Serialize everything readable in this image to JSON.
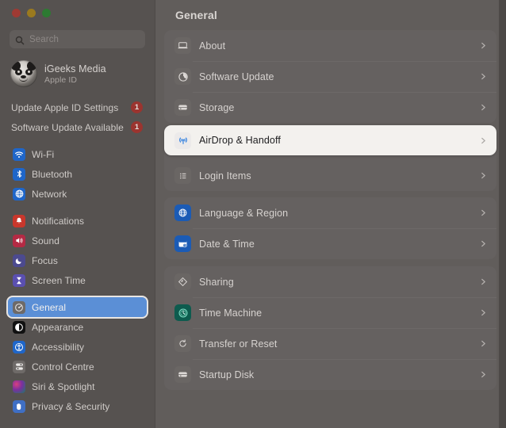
{
  "window": {
    "traffic_lights": [
      "close",
      "minimize",
      "zoom"
    ],
    "sidebar": {
      "search": {
        "placeholder": "Search",
        "value": ""
      },
      "account": {
        "name": "iGeeks Media",
        "subtitle": "Apple ID"
      },
      "alerts": [
        {
          "label": "Update Apple ID Settings",
          "badge": "1"
        },
        {
          "label": "Software Update Available",
          "badge": "1"
        }
      ],
      "groups": [
        {
          "items": [
            {
              "label": "Wi-Fi",
              "icon": "wifi-icon",
              "color": "#1f66c9"
            },
            {
              "label": "Bluetooth",
              "icon": "bluetooth-icon",
              "color": "#1f66c9"
            },
            {
              "label": "Network",
              "icon": "network-globe-icon",
              "color": "#1f66c9"
            }
          ]
        },
        {
          "items": [
            {
              "label": "Notifications",
              "icon": "notifications-bell-icon",
              "color": "#c9372c"
            },
            {
              "label": "Sound",
              "icon": "sound-speaker-icon",
              "color": "#b42a44"
            },
            {
              "label": "Focus",
              "icon": "focus-moon-icon",
              "color": "#4c4a8f"
            },
            {
              "label": "Screen Time",
              "icon": "screen-time-hourglass-icon",
              "color": "#5a4fb0"
            }
          ]
        },
        {
          "items": [
            {
              "label": "General",
              "icon": "general-gear-icon",
              "color": "#6e6a68",
              "selected": true
            },
            {
              "label": "Appearance",
              "icon": "appearance-contrast-icon",
              "color": "#1a1a1a"
            },
            {
              "label": "Accessibility",
              "icon": "accessibility-person-icon",
              "color": "#1f66c9"
            },
            {
              "label": "Control Centre",
              "icon": "control-centre-icon",
              "color": "#6e6a68"
            },
            {
              "label": "Siri & Spotlight",
              "icon": "siri-icon",
              "color": "#2a2a3a"
            },
            {
              "label": "Privacy & Security",
              "icon": "privacy-hand-icon",
              "color": "#3f6fc4"
            }
          ]
        }
      ]
    },
    "content": {
      "title": "General",
      "groups": [
        {
          "rows": [
            {
              "label": "About",
              "icon": "about-laptop-icon"
            },
            {
              "label": "Software Update",
              "icon": "software-update-icon"
            },
            {
              "label": "Storage",
              "icon": "storage-drive-icon"
            }
          ]
        },
        {
          "rows": [
            {
              "label": "AirDrop & Handoff",
              "icon": "airdrop-icon",
              "highlighted": true
            },
            {
              "label": "Login Items",
              "icon": "login-items-list-icon"
            }
          ]
        },
        {
          "rows": [
            {
              "label": "Language & Region",
              "icon": "language-region-globe-icon"
            },
            {
              "label": "Date & Time",
              "icon": "date-time-icon"
            }
          ]
        },
        {
          "rows": [
            {
              "label": "Sharing",
              "icon": "sharing-icon"
            },
            {
              "label": "Time Machine",
              "icon": "time-machine-icon"
            },
            {
              "label": "Transfer or Reset",
              "icon": "transfer-reset-icon"
            },
            {
              "label": "Startup Disk",
              "icon": "startup-disk-icon"
            }
          ]
        }
      ],
      "chevron": "chevron-right-icon"
    }
  },
  "colors": {
    "selection_blue": "#5b8fd6",
    "badge_red": "#9b342f",
    "highlight_bg": "#f3f1ee",
    "sidebar_bg": "#565250",
    "content_bg": "#615d5b"
  }
}
